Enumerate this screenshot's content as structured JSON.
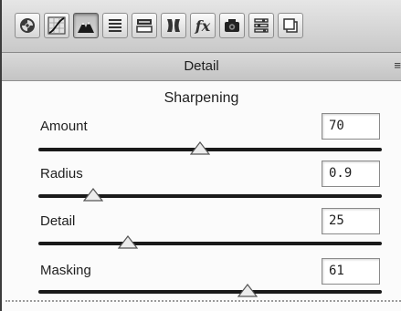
{
  "toolbar": {
    "tools": [
      {
        "icon": "basic-panel-icon"
      },
      {
        "icon": "tone-curve-icon"
      },
      {
        "icon": "detail-icon",
        "active": true
      },
      {
        "icon": "hsl-grayscale-icon"
      },
      {
        "icon": "split-toning-icon"
      },
      {
        "icon": "lens-corrections-icon"
      },
      {
        "icon": "effects-icon",
        "glyph": "fx"
      },
      {
        "icon": "camera-calibration-icon"
      },
      {
        "icon": "presets-icon"
      },
      {
        "icon": "snapshots-icon"
      }
    ]
  },
  "header": {
    "title": "Detail",
    "menu_icon": "panel-menu-icon",
    "menu_glyph": "≡"
  },
  "sharpening": {
    "title": "Sharpening",
    "amount": {
      "label": "Amount",
      "value": "70",
      "slider_fraction": 0.47
    },
    "radius": {
      "label": "Radius",
      "value": "0.9",
      "slider_fraction": 0.16
    },
    "detail": {
      "label": "Detail",
      "value": "25",
      "slider_fraction": 0.26
    },
    "masking": {
      "label": "Masking",
      "value": "61",
      "slider_fraction": 0.61
    }
  }
}
